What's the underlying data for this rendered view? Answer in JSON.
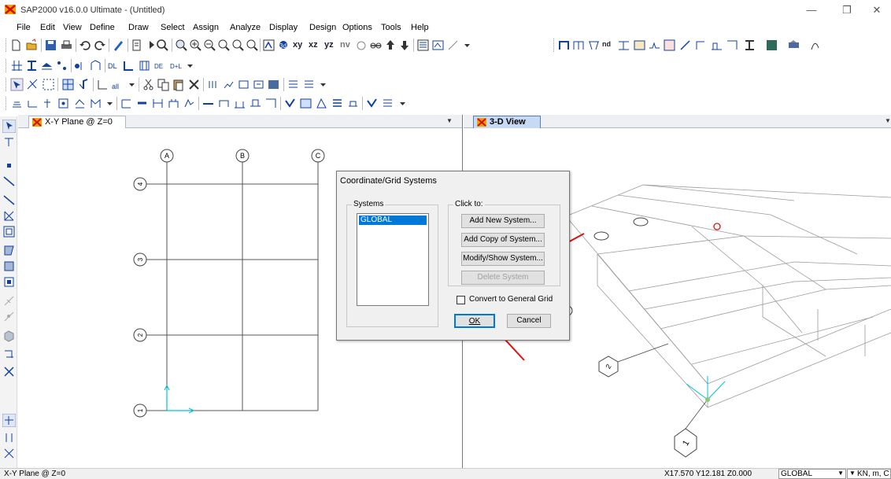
{
  "title_bar": {
    "title": "SAP2000 v16.0.0 Ultimate  - (Untitled)",
    "minimize": "—",
    "restore": "❐",
    "close": "✕"
  },
  "menu": [
    "File",
    "Edit",
    "View",
    "Define",
    "Draw",
    "Select",
    "Assign",
    "Analyze",
    "Display",
    "Design",
    "Options",
    "Tools",
    "Help"
  ],
  "toolbar": {
    "view_xy": "xy",
    "view_xz": "xz",
    "view_yz": "yz",
    "view_nv": "nv",
    "nd_label": "nd"
  },
  "windows": {
    "left": {
      "tab_title": "X-Y Plane @ Z=0",
      "grid_x_labels": [
        "A",
        "B",
        "C"
      ],
      "grid_y_labels": [
        "4",
        "3",
        "2",
        "1"
      ]
    },
    "right": {
      "tab_title": "3-D View",
      "grid_labels": [
        "2",
        "1"
      ]
    }
  },
  "dialog": {
    "title": "Coordinate/Grid Systems",
    "systems_label": "Systems",
    "systems": [
      "GLOBAL"
    ],
    "selected_system": "GLOBAL",
    "click_to_label": "Click to:",
    "buttons": {
      "add_new": "Add New System...",
      "add_copy": "Add Copy of System...",
      "modify_show": "Modify/Show System...",
      "delete": "Delete System"
    },
    "convert_label": "Convert to General Grid",
    "convert_checked": false,
    "ok": "OK",
    "cancel": "Cancel"
  },
  "status_bar": {
    "left": "X-Y Plane @ Z=0",
    "coords": "X17.570  Y12.181  Z0.000",
    "coord_system": "GLOBAL",
    "units": "KN, m, C"
  },
  "colors": {
    "annotation_arrow": "#e01010",
    "selection": "#0078d7",
    "axis": "#00c0e0",
    "grid_lines": "#555555"
  }
}
